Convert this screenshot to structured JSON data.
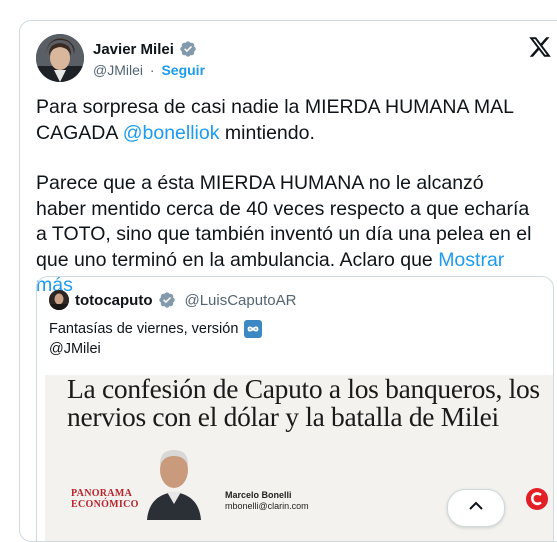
{
  "tweet": {
    "author_name": "Javier Milei",
    "author_handle": "@JMilei",
    "separator": "·",
    "follow_label": "Seguir",
    "text_p1_a": "Para sorpresa de casi nadie la MIERDA HUMANA MAL CAGADA ",
    "text_p1_mention": "@bonelliok",
    "text_p1_b": " mintiendo.",
    "text_p2": "Parece que a ésta MIERDA HUMANA no le alcanzó haber mentido cerca de 40 veces respecto a que echaría a TOTO, sino que también inventó un día una pelea en el que uno terminó en la ambulancia. Aclaro que ",
    "show_more": "Mostrar más"
  },
  "quote": {
    "author_name": "totocaputo",
    "author_handle": "@LuisCaputoAR",
    "text_line1": "Fantasías de viernes, versión",
    "text_line2": "@JMilei",
    "image": {
      "headline": "La confesión de Caputo a los banqueros, los nervios con el dólar y la batalla de Milei",
      "section_line1": "PANORAMA",
      "section_line2": "ECONÓMICO",
      "byline_name": "Marcelo Bonelli",
      "byline_email": "mbonelli@clarin.com"
    }
  },
  "colors": {
    "accent": "#1d9bf0",
    "text": "#0f1419",
    "secondary": "#536471",
    "border": "#cfd9de",
    "clarin_red": "#e31e24"
  },
  "icons": {
    "verified": "verified-badge-icon",
    "x_logo": "x-logo-icon",
    "infinity": "infinity-emoji-icon",
    "scroll_up": "chevron-up-icon"
  }
}
